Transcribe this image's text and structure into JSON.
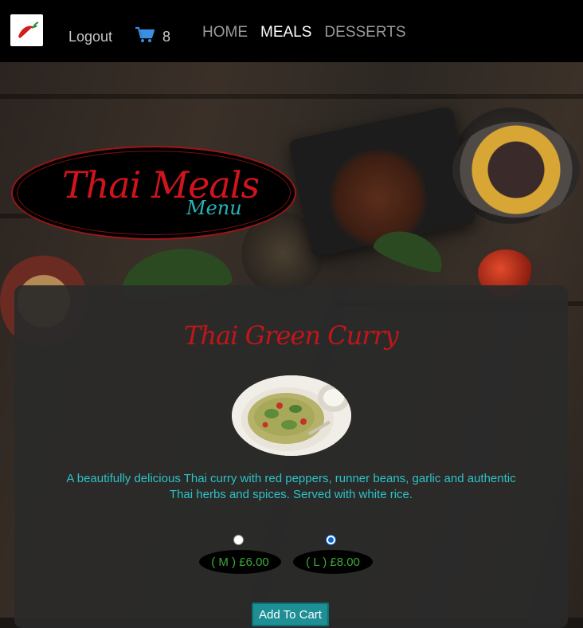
{
  "nav": {
    "logo_icon": "chili-pepper-logo-icon",
    "logout_label": "Logout",
    "cart_icon": "shopping-cart-icon",
    "cart_count": "8",
    "links": [
      {
        "label": "HOME",
        "active": false
      },
      {
        "label": "MEALS",
        "active": true
      },
      {
        "label": "DESSERTS",
        "active": false
      }
    ]
  },
  "header": {
    "title": "Thai Meals",
    "subtitle": "Menu"
  },
  "meal": {
    "name": "Thai Green Curry",
    "image_icon": "green-curry-dish-image",
    "description": "A beautifully delicious Thai curry with red peppers, runner beans, garlic and authentic Thai herbs and spices. Served with white rice.",
    "sizes": [
      {
        "label": "( M ) £6.00",
        "selected": false
      },
      {
        "label": "( L ) £8.00",
        "selected": true
      }
    ],
    "add_to_cart_label": "Add To Cart"
  },
  "colors": {
    "nav_bg": "#000000",
    "title_red": "#d0141c",
    "accent_teal": "#27b3b8",
    "price_green": "#3da93a",
    "button_teal": "#1d8f95"
  }
}
